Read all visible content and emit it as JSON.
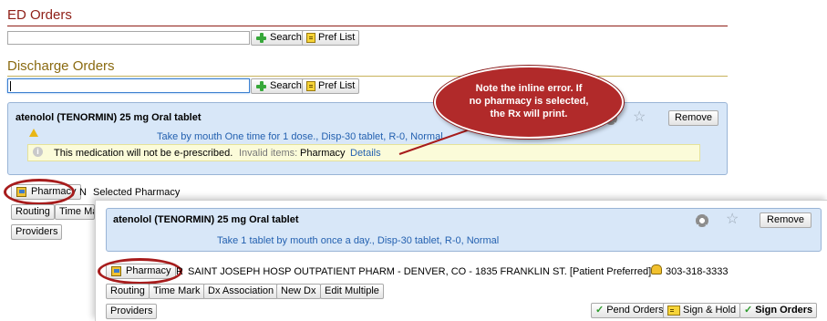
{
  "ed_orders": {
    "title": "ED Orders",
    "search_label": "Search",
    "pref_list_label": "Pref List"
  },
  "discharge_orders": {
    "title": "Discharge Orders",
    "search_label": "Search",
    "pref_list_label": "Pref List"
  },
  "callout": {
    "line1": "Note the inline error. If",
    "line2": "no pharmacy is selected,",
    "line3": "the Rx will print."
  },
  "order_before": {
    "name": "atenolol (TENORMIN) 25 mg Oral tablet",
    "sig": "Take  by mouth One time for 1 dose., Disp-30 tablet, R-0, Normal",
    "remove_label": "Remove",
    "warning_text": "This medication will not be e-prescribed.",
    "invalid_label": "Invalid items:",
    "invalid_value": "Pharmacy",
    "details_link": "Details"
  },
  "pharmacy_row_before": {
    "button_label": "Pharmacy",
    "no_pharmacy_prefix": "N",
    "selected_text": "Selected Pharmacy"
  },
  "toolbar_before": {
    "routing_label": "Routing",
    "time_mark_label": "Time Ma",
    "providers_label": "Providers"
  },
  "order_after": {
    "name": "atenolol (TENORMIN) 25 mg Oral tablet",
    "sig": "Take 1 tablet by mouth once a day., Disp-30 tablet, R-0, Normal",
    "remove_label": "Remove"
  },
  "pharmacy_row_after": {
    "button_label": "Pharmacy",
    "prefix": "R",
    "pharmacy_text": "SAINT JOSEPH HOSP OUTPATIENT PHARM - DENVER, CO - 1835 FRANKLIN ST. [Patient Preferred]",
    "phone": "303-318-3333"
  },
  "toolbar_after": {
    "routing_label": "Routing",
    "time_mark_label": "Time Mark",
    "dx_association_label": "Dx Association",
    "new_dx_label": "New Dx",
    "edit_multiple_label": "Edit Multiple",
    "providers_label": "Providers",
    "pend_orders_label": "Pend Orders",
    "sign_hold_label": "Sign & Hold",
    "sign_orders_label": "Sign Orders"
  },
  "colors": {
    "section_title": "#8f1f17",
    "discharge_title": "#8a6a10",
    "panel_blue": "#d8e7f8",
    "link_blue": "#2461b0",
    "callout_red": "#b12a2a"
  }
}
